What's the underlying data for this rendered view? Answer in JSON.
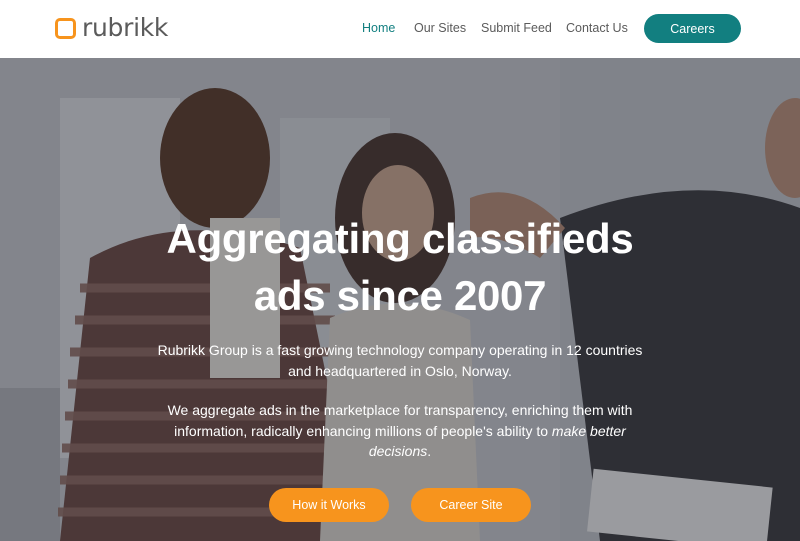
{
  "brand": {
    "name": "rubrikk",
    "accent": "#f7941d",
    "primary": "#127f80"
  },
  "nav": {
    "home": "Home",
    "our_sites": "Our Sites",
    "submit_feed": "Submit Feed",
    "contact_us": "Contact Us",
    "careers": "Careers"
  },
  "hero": {
    "title_line1": "Aggregating classifieds",
    "title_line2": "ads since 2007",
    "paragraph1": "Rubrikk Group is a fast growing technology company operating in 12 countries and headquartered in Oslo, Norway.",
    "paragraph2_start": "We aggregate ads in the marketplace for transparency, enriching them with information, radically enhancing millions of people's ability to ",
    "paragraph2_emphasis": "make better decisions",
    "paragraph2_end": ".",
    "buttons": {
      "how_it_works": "How it Works",
      "career_site": "Career Site"
    }
  }
}
